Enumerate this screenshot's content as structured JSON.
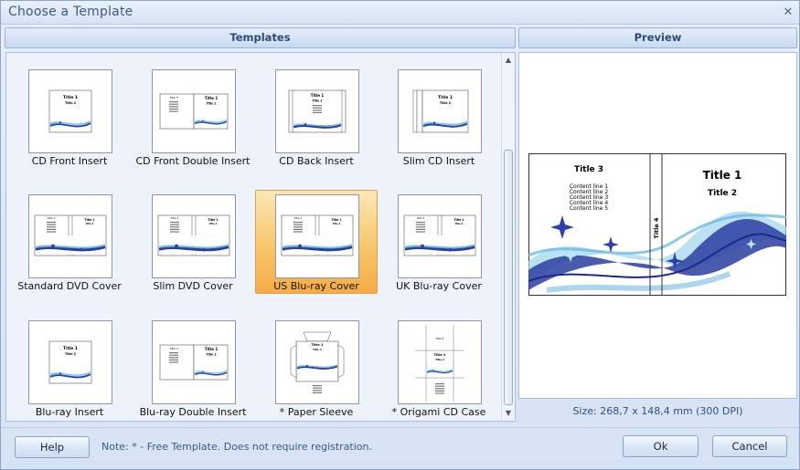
{
  "window": {
    "title": "Choose a Template",
    "close_glyph": "✕"
  },
  "templates_panel": {
    "header": "Templates",
    "items": [
      {
        "label": "CD Front Insert",
        "kind": "single"
      },
      {
        "label": "CD Front Double Insert",
        "kind": "double"
      },
      {
        "label": "CD Back Insert",
        "kind": "back"
      },
      {
        "label": "Slim CD Insert",
        "kind": "slim"
      },
      {
        "label": "Standard DVD Cover",
        "kind": "dvd"
      },
      {
        "label": "Slim DVD Cover",
        "kind": "dvd"
      },
      {
        "label": "US Blu-ray Cover",
        "kind": "dvd",
        "selected": true
      },
      {
        "label": "UK Blu-ray Cover",
        "kind": "dvd"
      },
      {
        "label": "Blu-ray Insert",
        "kind": "single"
      },
      {
        "label": "Blu-ray Double Insert",
        "kind": "double"
      },
      {
        "label": "* Paper Sleeve",
        "kind": "sleeve"
      },
      {
        "label": "* Origami CD Case",
        "kind": "origami"
      }
    ],
    "scroll_up_glyph": "▲",
    "scroll_down_glyph": "▼"
  },
  "preview_panel": {
    "header": "Preview",
    "title1": "Title 1",
    "title2": "Title 2",
    "title3": "Title 3",
    "title4": "Title 4",
    "content_lines": [
      "Content line 1",
      "Content line 2",
      "Content line 3",
      "Content line 4",
      "Content line 5"
    ],
    "size_text": "Size: 268,7 x 148,4 mm (300 DPI)"
  },
  "footer": {
    "help_label": "Help",
    "note": "Note: * - Free Template. Does not require registration.",
    "ok_label": "Ok",
    "cancel_label": "Cancel"
  },
  "colors": {
    "accent": "#3a5fb0",
    "swirl_light": "#7ec7ea",
    "swirl_dark": "#1d2f8f",
    "selected_tile": "#f8c66c"
  }
}
